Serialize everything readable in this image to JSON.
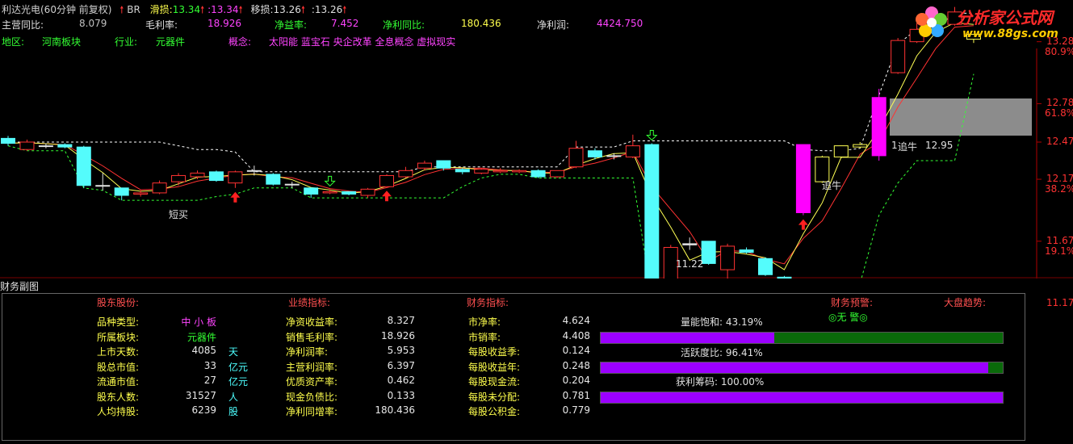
{
  "header": {
    "title": "利达光电(60分钟 前复权)",
    "indicator": "BR",
    "stop_loss_label": "滑损:",
    "stop_loss_value1": "13.34",
    "stop_loss_value2": ":13.34",
    "trailing_label": "移损:",
    "trailing_value1": "13.26",
    "trailing_value2": ":13.26"
  },
  "stats": [
    {
      "label": "主营同比:",
      "value": "8.079"
    },
    {
      "label": "毛利率:",
      "value": "18.926"
    },
    {
      "label": "净益率:",
      "value": "7.452"
    },
    {
      "label": "净利同比:",
      "value": "180.436"
    },
    {
      "label": "净利润:",
      "value": "4424.750"
    }
  ],
  "info": {
    "region_label": "地区:",
    "region": "河南板块",
    "industry_label": "行业:",
    "industry": "元器件",
    "concept_label": "概念:",
    "concepts": "太阳能 蓝宝石 央企改革 全息概念 虚拟现实"
  },
  "logo": {
    "text": "分析家公式网",
    "url": "www.88gs.com"
  },
  "price_axis": [
    {
      "price": "13.28",
      "pct": "80.9%"
    },
    {
      "price": "12.78",
      "pct": "61.8%"
    },
    {
      "price": "12.47",
      "pct": ""
    },
    {
      "price": "12.17",
      "pct": "38.2%"
    },
    {
      "price": "11.67",
      "pct": "19.1%"
    },
    {
      "price": "11.17",
      "pct": ""
    }
  ],
  "annotations": {
    "short_sell": "短买",
    "chase1": "追牛",
    "chase2": "追牛",
    "low_price": "11.22",
    "mark_price": "12.95",
    "mark_prefix": "1"
  },
  "candles": [
    {
      "o": 12.5,
      "c": 12.46,
      "h": 12.52,
      "l": 12.44,
      "color": "cyan"
    },
    {
      "o": 12.41,
      "c": 12.47,
      "h": 12.49,
      "l": 12.4,
      "color": "red"
    },
    {
      "o": 12.44,
      "c": 12.44,
      "h": 12.46,
      "l": 12.42,
      "color": "white"
    },
    {
      "o": 12.45,
      "c": 12.43,
      "h": 12.46,
      "l": 12.42,
      "color": "cyan"
    },
    {
      "o": 12.43,
      "c": 12.12,
      "h": 12.44,
      "l": 12.1,
      "color": "cyan"
    },
    {
      "o": 12.12,
      "c": 12.12,
      "h": 12.22,
      "l": 12.08,
      "color": "white"
    },
    {
      "o": 12.1,
      "c": 12.04,
      "h": 12.1,
      "l": 12.0,
      "color": "cyan"
    },
    {
      "o": 12.05,
      "c": 12.06,
      "h": 12.08,
      "l": 12.03,
      "color": "red"
    },
    {
      "o": 12.06,
      "c": 12.14,
      "h": 12.16,
      "l": 12.05,
      "color": "red"
    },
    {
      "o": 12.15,
      "c": 12.2,
      "h": 12.22,
      "l": 12.12,
      "color": "red"
    },
    {
      "o": 12.19,
      "c": 12.22,
      "h": 12.24,
      "l": 12.17,
      "color": "red"
    },
    {
      "o": 12.23,
      "c": 12.16,
      "h": 12.24,
      "l": 12.15,
      "color": "cyan"
    },
    {
      "o": 12.14,
      "c": 12.23,
      "h": 12.24,
      "l": 12.1,
      "color": "red"
    },
    {
      "o": 12.24,
      "c": 12.24,
      "h": 12.28,
      "l": 12.2,
      "color": "white"
    },
    {
      "o": 12.21,
      "c": 12.13,
      "h": 12.22,
      "l": 12.12,
      "color": "cyan"
    },
    {
      "o": 12.13,
      "c": 12.13,
      "h": 12.15,
      "l": 12.1,
      "color": "white"
    },
    {
      "o": 12.1,
      "c": 12.05,
      "h": 12.1,
      "l": 12.02,
      "color": "cyan"
    },
    {
      "o": 12.06,
      "c": 12.07,
      "h": 12.09,
      "l": 12.05,
      "color": "red"
    },
    {
      "o": 12.07,
      "c": 12.05,
      "h": 12.07,
      "l": 12.04,
      "color": "cyan"
    },
    {
      "o": 12.04,
      "c": 12.09,
      "h": 12.1,
      "l": 12.02,
      "color": "red"
    },
    {
      "o": 12.11,
      "c": 12.2,
      "h": 12.21,
      "l": 12.11,
      "color": "red"
    },
    {
      "o": 12.19,
      "c": 12.24,
      "h": 12.27,
      "l": 12.18,
      "color": "red"
    },
    {
      "o": 12.26,
      "c": 12.3,
      "h": 12.32,
      "l": 12.24,
      "color": "red"
    },
    {
      "o": 12.32,
      "c": 12.26,
      "h": 12.32,
      "l": 12.24,
      "color": "cyan"
    },
    {
      "o": 12.25,
      "c": 12.23,
      "h": 12.26,
      "l": 12.21,
      "color": "cyan"
    },
    {
      "o": 12.22,
      "c": 12.25,
      "h": 12.26,
      "l": 12.21,
      "color": "red"
    },
    {
      "o": 12.23,
      "c": 12.24,
      "h": 12.26,
      "l": 12.22,
      "color": "red"
    },
    {
      "o": 12.24,
      "c": 12.23,
      "h": 12.25,
      "l": 12.22,
      "color": "red"
    },
    {
      "o": 12.24,
      "c": 12.19,
      "h": 12.25,
      "l": 12.18,
      "color": "cyan"
    },
    {
      "o": 12.19,
      "c": 12.24,
      "h": 12.24,
      "l": 12.18,
      "color": "red"
    },
    {
      "o": 12.27,
      "c": 12.42,
      "h": 12.48,
      "l": 12.26,
      "color": "red"
    },
    {
      "o": 12.4,
      "c": 12.35,
      "h": 12.42,
      "l": 12.33,
      "color": "cyan"
    },
    {
      "o": 12.36,
      "c": 12.36,
      "h": 12.38,
      "l": 12.33,
      "color": "white"
    },
    {
      "o": 12.35,
      "c": 12.44,
      "h": 12.53,
      "l": 12.34,
      "color": "red"
    },
    {
      "o": 12.45,
      "c": 11.29,
      "h": 12.46,
      "l": 11.22,
      "color": "cyan"
    },
    {
      "o": 11.3,
      "c": 11.62,
      "h": 11.64,
      "l": 11.3,
      "color": "red"
    },
    {
      "o": 11.65,
      "c": 11.64,
      "h": 11.7,
      "l": 11.6,
      "color": "white"
    },
    {
      "o": 11.67,
      "c": 11.49,
      "h": 11.67,
      "l": 11.48,
      "color": "cyan"
    },
    {
      "o": 11.44,
      "c": 11.63,
      "h": 11.65,
      "l": 11.33,
      "color": "red"
    },
    {
      "o": 11.6,
      "c": 11.58,
      "h": 11.62,
      "l": 11.57,
      "color": "cyan"
    },
    {
      "o": 11.53,
      "c": 11.4,
      "h": 11.54,
      "l": 11.39,
      "color": "cyan"
    },
    {
      "o": 11.38,
      "c": 11.34,
      "h": 11.39,
      "l": 11.33,
      "color": "cyan"
    },
    {
      "o": 11.9,
      "c": 12.45,
      "h": 12.45,
      "l": 11.88,
      "color": "magenta"
    },
    {
      "o": 12.35,
      "c": 12.15,
      "h": 12.36,
      "l": 12.14,
      "color": "yellow"
    },
    {
      "o": 12.35,
      "c": 12.44,
      "h": 12.44,
      "l": 12.34,
      "color": "yellow"
    },
    {
      "o": 12.43,
      "c": 12.45,
      "h": 12.47,
      "l": 12.42,
      "color": "yellow"
    },
    {
      "o": 12.36,
      "c": 12.83,
      "h": 12.9,
      "l": 12.32,
      "color": "magenta"
    },
    {
      "o": 13.03,
      "c": 13.29,
      "h": 13.31,
      "l": 13.02,
      "color": "red"
    },
    {
      "o": 13.28,
      "c": 13.38,
      "h": 13.43,
      "l": 13.27,
      "color": "red"
    },
    {
      "o": 13.35,
      "c": 13.4,
      "h": 13.44,
      "l": 13.33,
      "color": "red"
    },
    {
      "o": 13.42,
      "c": 13.52,
      "h": 13.56,
      "l": 13.41,
      "color": "red"
    },
    {
      "o": 13.3,
      "c": 13.34,
      "h": 13.34,
      "l": 13.27,
      "color": "yellow"
    }
  ],
  "sub_panel": {
    "title": "财务副图",
    "section_headers": [
      "股东股份:",
      "业绩指标:",
      "财务指标:",
      "财务预警:",
      "大盘趋势:"
    ],
    "warning_status": "◎无 警◎",
    "col1": [
      {
        "label": "品种类型:",
        "value": "中 小 板",
        "unit": ""
      },
      {
        "label": "所属板块:",
        "value": "元器件",
        "unit": ""
      },
      {
        "label": "上市天数:",
        "value": "4085",
        "unit": "天"
      },
      {
        "label": "股总市值:",
        "value": "33",
        "unit": "亿元"
      },
      {
        "label": "流通市值:",
        "value": "27",
        "unit": "亿元"
      },
      {
        "label": "股东人数:",
        "value": "31527",
        "unit": "人"
      },
      {
        "label": "人均持股:",
        "value": "6239",
        "unit": "股"
      }
    ],
    "col2": [
      {
        "label": "净资收益率:",
        "value": "8.327"
      },
      {
        "label": "销售毛利率:",
        "value": "18.926"
      },
      {
        "label": "净利润率:",
        "value": "5.953"
      },
      {
        "label": "主营利润率:",
        "value": "6.397"
      },
      {
        "label": "优质资产率:",
        "value": "0.462"
      },
      {
        "label": "现金负债比:",
        "value": "0.133"
      },
      {
        "label": "净利同增率:",
        "value": "180.436"
      }
    ],
    "col3": [
      {
        "label": "市净率:",
        "value": "4.624"
      },
      {
        "label": "市销率:",
        "value": "4.408"
      },
      {
        "label": "每股收益季:",
        "value": "0.124"
      },
      {
        "label": "每股收益年:",
        "value": "0.248"
      },
      {
        "label": "每股现金流:",
        "value": "0.204"
      },
      {
        "label": "每股未分配:",
        "value": "0.781"
      },
      {
        "label": "每股公积金:",
        "value": "0.779"
      }
    ],
    "bars": [
      {
        "label": "量能饱和:",
        "value": "43.19%",
        "fraction": 0.4319
      },
      {
        "label": "活跃度比:",
        "value": "96.41%",
        "fraction": 0.9641
      },
      {
        "label": "获利筹码:",
        "value": "100.00%",
        "fraction": 1.0
      }
    ]
  },
  "colors": {
    "cyan": "#54fcfc",
    "red": "#ff3232",
    "magenta": "#ff00ff",
    "yellow": "#ffff54",
    "white": "#e0e0e0"
  }
}
